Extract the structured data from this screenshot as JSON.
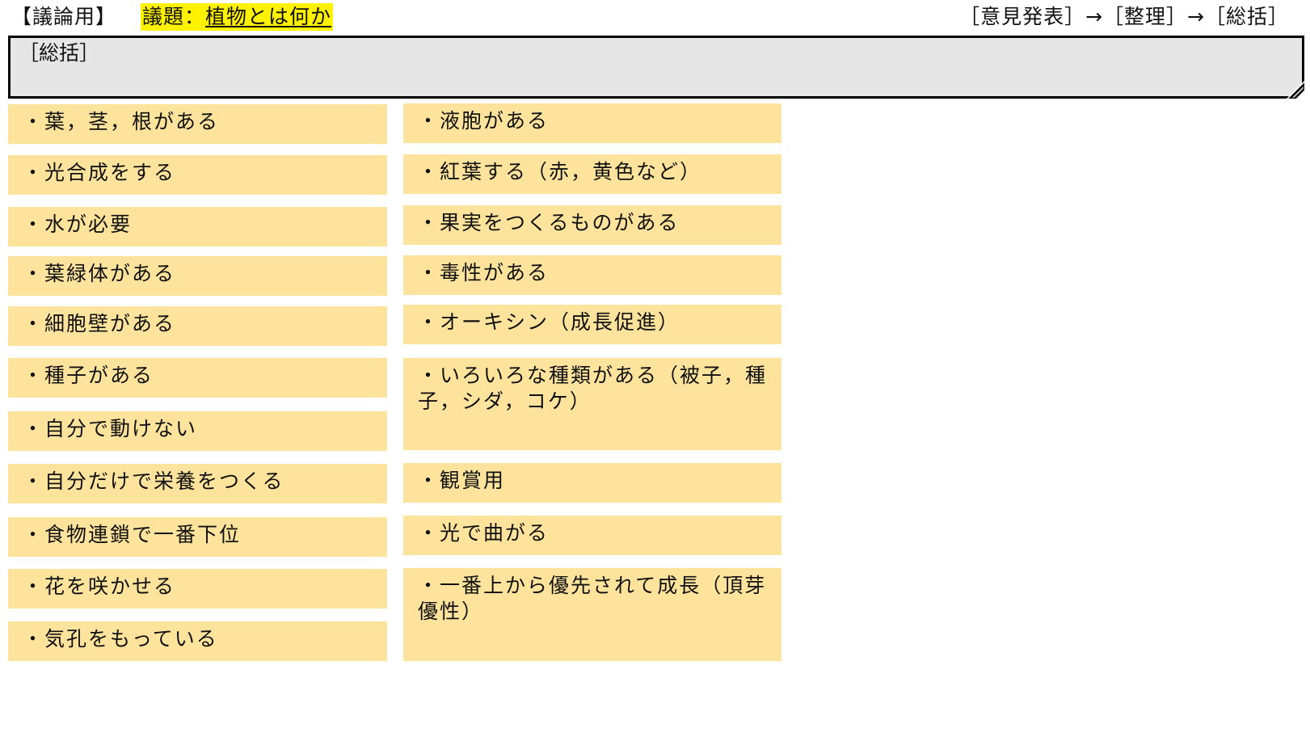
{
  "header": {
    "tag": "【議論用】",
    "topic_prefix": "議題：",
    "topic_value": "植物とは何か",
    "process": "［意見発表］→［整理］→［総括］"
  },
  "summary": {
    "label": "［総括］"
  },
  "notes_left": [
    "・葉，茎，根がある",
    "・光合成をする",
    "・水が必要",
    "・葉緑体がある",
    "・細胞壁がある",
    "・種子がある",
    "・自分で動けない",
    "・自分だけで栄養をつくる",
    "・食物連鎖で一番下位",
    "・花を咲かせる",
    "・気孔をもっている"
  ],
  "notes_right": [
    "・液胞がある",
    "・紅葉する（赤，黄色など）",
    "・果実をつくるものがある",
    "・毒性がある",
    "・オーキシン（成長促進）",
    "・いろいろな種類がある（被子，種子，シダ，コケ）",
    "・観賞用",
    "・光で曲がる",
    "・一番上から優先されて成長（頂芽優性）"
  ],
  "colors": {
    "note_fill": "#fde39b",
    "topic_highlight": "#fff200",
    "summary_fill": "#e6e6e6"
  }
}
